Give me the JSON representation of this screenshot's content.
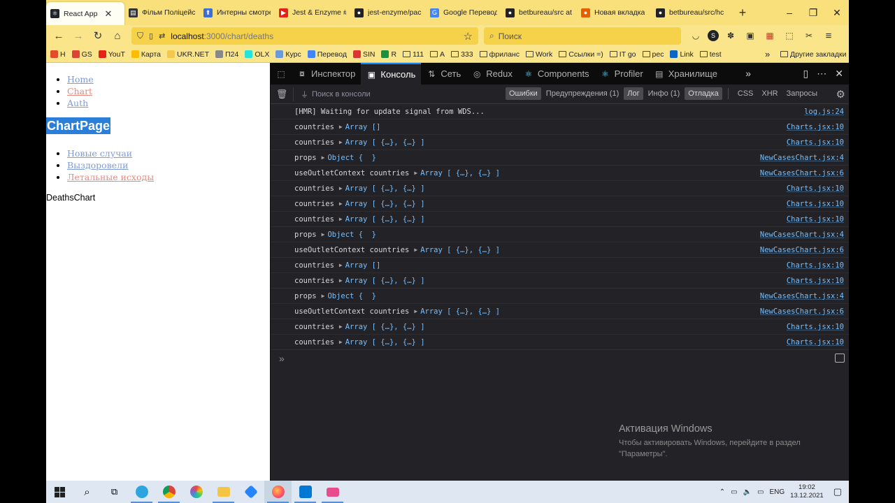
{
  "browser": {
    "tabs": [
      {
        "label": "React App",
        "icon": "react-icon",
        "color": "#20232a",
        "active": true
      },
      {
        "label": "Фільм Поліцейсь",
        "icon": "film-icon",
        "color": "#333333"
      },
      {
        "label": "Интерны смотре",
        "icon": "arrow-up-icon",
        "color": "#3b6fd6"
      },
      {
        "label": "Jest & Enzyme #",
        "icon": "youtube-icon",
        "color": "#e62117"
      },
      {
        "label": "jest-enzyme/pack",
        "icon": "github-icon",
        "color": "#222222"
      },
      {
        "label": "Google Переводч",
        "icon": "translate-icon",
        "color": "#4285f4"
      },
      {
        "label": "betbureau/src at",
        "icon": "github-icon",
        "color": "#222222"
      },
      {
        "label": "Новая вкладка",
        "icon": "firefox-icon",
        "color": "#e66000"
      },
      {
        "label": "betbureau/src/hc",
        "icon": "github-icon",
        "color": "#222222"
      }
    ],
    "new_tab": "+",
    "window_controls": {
      "minimize": "–",
      "maximize": "❐",
      "close": "✕"
    },
    "url": {
      "host": "localhost",
      "path": ":3000/chart/deaths"
    },
    "search_placeholder": "Поиск",
    "bookmarks": [
      {
        "label": "Н",
        "type": "icon",
        "color": "#e34c26"
      },
      {
        "label": "GS",
        "type": "icon",
        "color": "#db4437"
      },
      {
        "label": "YouT",
        "type": "icon",
        "color": "#e62117"
      },
      {
        "label": "Карта",
        "type": "icon",
        "color": "#fbbc05"
      },
      {
        "label": "UKR.NET",
        "type": "icon",
        "color": "#f2c94c"
      },
      {
        "label": "П24",
        "type": "icon",
        "color": "#888888"
      },
      {
        "label": "OLX",
        "type": "icon",
        "color": "#23e5db"
      },
      {
        "label": "Курс",
        "type": "icon",
        "color": "#6a9ad8"
      },
      {
        "label": "Перевод",
        "type": "icon",
        "color": "#4285f4"
      },
      {
        "label": "SIN",
        "type": "icon",
        "color": "#d33"
      },
      {
        "label": "R",
        "type": "icon",
        "color": "#1d8f3e"
      },
      {
        "label": "111",
        "type": "folder"
      },
      {
        "label": "A",
        "type": "folder"
      },
      {
        "label": "333",
        "type": "folder"
      },
      {
        "label": "фриланс",
        "type": "folder"
      },
      {
        "label": "Work",
        "type": "folder"
      },
      {
        "label": "Ссылки =)",
        "type": "folder"
      },
      {
        "label": "IT go",
        "type": "folder"
      },
      {
        "label": "рес",
        "type": "folder"
      },
      {
        "label": "Link",
        "type": "icon",
        "color": "#0a66c2"
      },
      {
        "label": "test",
        "type": "folder"
      }
    ],
    "bookmarks_more": "»",
    "other_bookmarks": "Другие закладки"
  },
  "page": {
    "nav": [
      "Home",
      "Chart",
      "Auth"
    ],
    "title": "ChartPage",
    "subnav": [
      "Новые случаи",
      "Выздоровели",
      "Летальные исходы"
    ],
    "content": "DeathsChart"
  },
  "devtools": {
    "tabs": [
      {
        "label": "",
        "icon": "pick-element-icon"
      },
      {
        "label": "Инспектор",
        "icon": "inspector-icon"
      },
      {
        "label": "Консоль",
        "icon": "console-icon",
        "active": true
      },
      {
        "label": "Сеть",
        "icon": "network-icon"
      },
      {
        "label": "Redux",
        "icon": "redux-icon"
      },
      {
        "label": "Components",
        "icon": "react-components-icon"
      },
      {
        "label": "Profiler",
        "icon": "react-profiler-icon"
      },
      {
        "label": "Хранилище",
        "icon": "storage-icon"
      }
    ],
    "filter_placeholder": "Поиск в консоли",
    "filter_buttons": [
      {
        "label": "Ошибки",
        "on": true
      },
      {
        "label": "Предупреждения (1)",
        "on": false
      },
      {
        "label": "Лог",
        "on": true
      },
      {
        "label": "Инфо (1)",
        "on": false
      },
      {
        "label": "Отладка",
        "on": true
      }
    ],
    "filter_buttons2": [
      "CSS",
      "XHR",
      "Запросы"
    ],
    "console_rows": [
      {
        "text": "[HMR] Waiting for update signal from WDS...",
        "obj": "",
        "src": "log.js:24"
      },
      {
        "text": "countries",
        "obj": "Array []",
        "src": "Charts.jsx:10"
      },
      {
        "text": "countries",
        "obj": "Array [ {…}, {…} ]",
        "src": "Charts.jsx:10"
      },
      {
        "text": "props",
        "obj": "Object {  }",
        "src": "NewCasesChart.jsx:4"
      },
      {
        "text": "useOutletContext countries",
        "obj": "Array [ {…}, {…} ]",
        "src": "NewCasesChart.jsx:6"
      },
      {
        "text": "countries",
        "obj": "Array [ {…}, {…} ]",
        "src": "Charts.jsx:10"
      },
      {
        "text": "countries",
        "obj": "Array [ {…}, {…} ]",
        "src": "Charts.jsx:10"
      },
      {
        "text": "countries",
        "obj": "Array [ {…}, {…} ]",
        "src": "Charts.jsx:10"
      },
      {
        "text": "props",
        "obj": "Object {  }",
        "src": "NewCasesChart.jsx:4"
      },
      {
        "text": "useOutletContext countries",
        "obj": "Array [ {…}, {…} ]",
        "src": "NewCasesChart.jsx:6"
      },
      {
        "text": "countries",
        "obj": "Array []",
        "src": "Charts.jsx:10"
      },
      {
        "text": "countries",
        "obj": "Array [ {…}, {…} ]",
        "src": "Charts.jsx:10"
      },
      {
        "text": "props",
        "obj": "Object {  }",
        "src": "NewCasesChart.jsx:4"
      },
      {
        "text": "useOutletContext countries",
        "obj": "Array [ {…}, {…} ]",
        "src": "NewCasesChart.jsx:6"
      },
      {
        "text": "countries",
        "obj": "Array [ {…}, {…} ]",
        "src": "Charts.jsx:10"
      },
      {
        "text": "countries",
        "obj": "Array [ {…}, {…} ]",
        "src": "Charts.jsx:10"
      }
    ],
    "prompt": "»"
  },
  "activation": {
    "title": "Активация Windows",
    "line1": "Чтобы активировать Windows, перейдите в раздел",
    "line2": "\"Параметры\"."
  },
  "taskbar": {
    "lang": "ENG",
    "time": "19:02",
    "date": "13.12.2021"
  }
}
